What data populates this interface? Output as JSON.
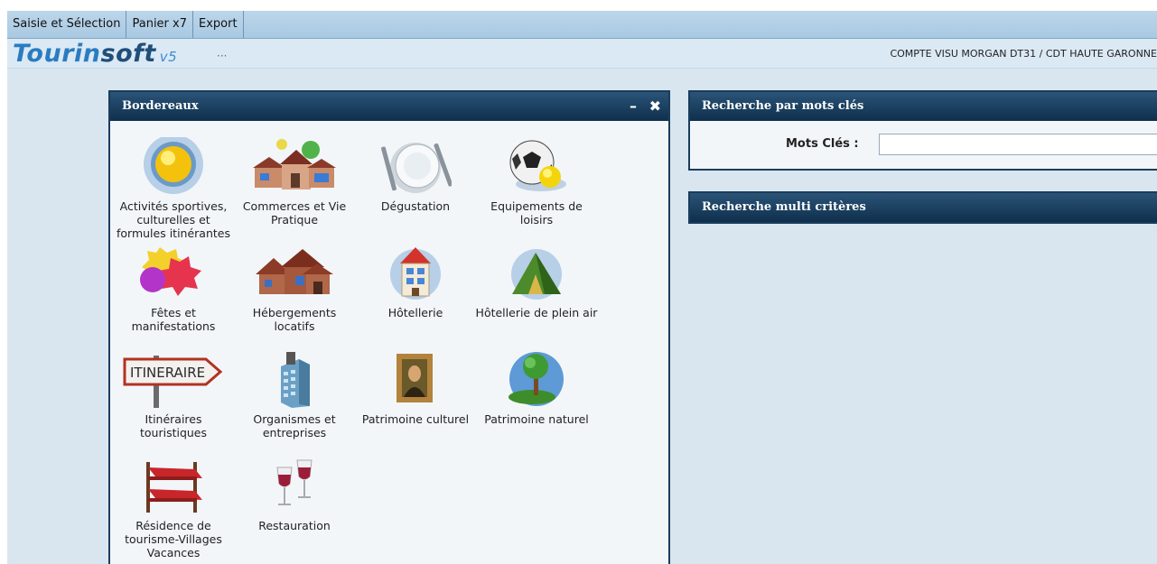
{
  "menu": {
    "items": [
      {
        "label": "Saisie et Sélection"
      },
      {
        "label": "Panier x7"
      },
      {
        "label": "Export"
      }
    ]
  },
  "brand": {
    "part1": "Tourin",
    "part2": "soft",
    "version": "v5",
    "dots": "···",
    "account": "COMPTE VISU MORGAN DT31 / CDT HAUTE GARONNE"
  },
  "bordereaux": {
    "title": "Bordereaux",
    "minimize": "–",
    "close": "✖",
    "categories": [
      {
        "label": "Activités sportives, culturelles et formules itinérantes",
        "icon": "yellow-ball-icon"
      },
      {
        "label": "Commerces et Vie Pratique",
        "icon": "shops-icon"
      },
      {
        "label": "Dégustation",
        "icon": "plate-cutlery-icon"
      },
      {
        "label": "Equipements de loisirs",
        "icon": "soccer-ball-icon"
      },
      {
        "label": "Fêtes et manifestations",
        "icon": "party-stars-icon"
      },
      {
        "label": "Hébergements locatifs",
        "icon": "houses-icon"
      },
      {
        "label": "Hôtellerie",
        "icon": "hotel-icon"
      },
      {
        "label": "Hôtellerie de plein air",
        "icon": "tent-icon"
      },
      {
        "label": "Itinéraires touristiques",
        "icon": "itinerary-sign-icon"
      },
      {
        "label": "Organismes et entreprises",
        "icon": "office-building-icon"
      },
      {
        "label": "Patrimoine culturel",
        "icon": "painting-icon"
      },
      {
        "label": "Patrimoine naturel",
        "icon": "tree-icon"
      },
      {
        "label": "Résidence de tourisme-Villages Vacances",
        "icon": "bunk-bed-icon"
      },
      {
        "label": "Restauration",
        "icon": "wine-glasses-icon"
      }
    ],
    "sign_text": "ITINERAIRE"
  },
  "search_keywords": {
    "title": "Recherche par mots clés",
    "field_label": "Mots Clés :",
    "value": "",
    "placeholder": ""
  },
  "search_multi": {
    "title": "Recherche multi critères"
  }
}
